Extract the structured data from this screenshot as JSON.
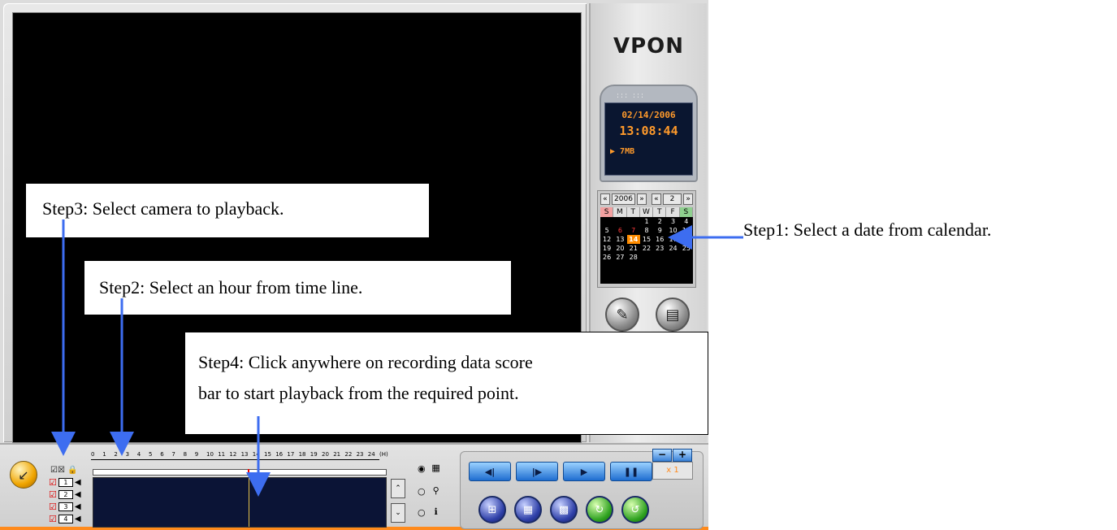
{
  "app": {
    "logo": "VPON",
    "lcd": {
      "date": "02/14/2006",
      "time": "13:08:44",
      "size": "7MB"
    },
    "calendar": {
      "year": "2006",
      "month": "2",
      "nav_prev_year": "«",
      "nav_next_year": "»",
      "nav_prev_month": "«",
      "nav_next_month": "»",
      "dow": [
        "S",
        "M",
        "T",
        "W",
        "T",
        "F",
        "S"
      ],
      "weeks": [
        [
          "",
          "",
          "",
          "1",
          "2",
          "3",
          "4"
        ],
        [
          "5",
          "6",
          "7",
          "8",
          "9",
          "10",
          "11"
        ],
        [
          "12",
          "13",
          "14",
          "15",
          "16",
          "17",
          "18"
        ],
        [
          "19",
          "20",
          "21",
          "22",
          "23",
          "24",
          "25"
        ],
        [
          "26",
          "27",
          "28",
          "",
          "",
          "",
          ""
        ]
      ],
      "selected_day": "14",
      "red_days": [
        "6",
        "7"
      ]
    },
    "timeline": {
      "hours": [
        "0",
        "1",
        "2",
        "3",
        "4",
        "5",
        "6",
        "7",
        "8",
        "9",
        "10",
        "11",
        "12",
        "13",
        "14",
        "15",
        "16",
        "17",
        "18",
        "19",
        "20",
        "21",
        "22",
        "23",
        "24"
      ],
      "unit": "(H)",
      "cameras": [
        "1",
        "2",
        "3",
        "4"
      ]
    },
    "zoom": {
      "minus": "−",
      "plus": "+",
      "value": "x 1"
    },
    "colors": {
      "accent": "#ff8a1c",
      "lcd_text": "#ff9a2b",
      "callout_arrow": "#3d6df0"
    }
  },
  "callouts": {
    "step1": "Step1: Select a date from calendar.",
    "step2": "Step2: Select an hour from time line.",
    "step3": "Step3: Select camera to playback.",
    "step4_line1": "Step4: Click anywhere on recording data score",
    "step4_line2": "bar to start playback from the required point."
  }
}
